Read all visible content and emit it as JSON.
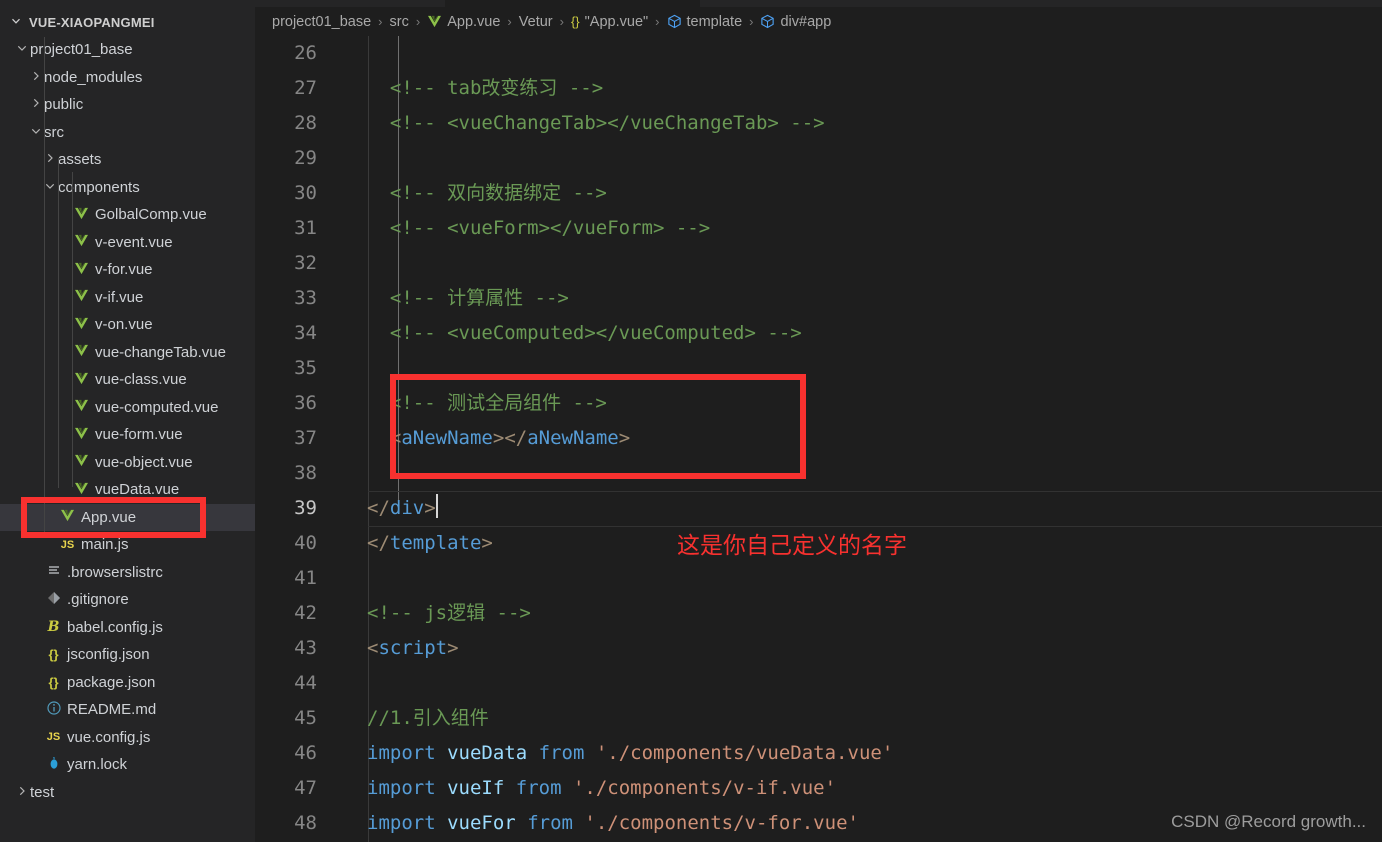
{
  "window": {
    "theme_bg": "#1e1e1e",
    "sidebar_bg": "#252526",
    "accent_red": "#f8312f"
  },
  "sidebar": {
    "title": "VUE-XIAOPANGMEI",
    "title_twisty": "chevron-down-icon",
    "items": [
      {
        "label": "project01_base",
        "twisty": "chevron-down-icon",
        "icon": "",
        "indent": 14,
        "selected": false
      },
      {
        "label": "node_modules",
        "twisty": "chevron-right-icon",
        "icon": "",
        "indent": 28,
        "selected": false
      },
      {
        "label": "public",
        "twisty": "chevron-right-icon",
        "icon": "",
        "indent": 28,
        "selected": false
      },
      {
        "label": "src",
        "twisty": "chevron-down-icon",
        "icon": "",
        "indent": 28,
        "selected": false
      },
      {
        "label": "assets",
        "twisty": "chevron-right-icon",
        "icon": "",
        "indent": 42,
        "selected": false
      },
      {
        "label": "components",
        "twisty": "chevron-down-icon",
        "icon": "",
        "indent": 42,
        "selected": false
      },
      {
        "label": "GolbalComp.vue",
        "twisty": "",
        "icon": "vue-icon",
        "indent": 56,
        "selected": false
      },
      {
        "label": "v-event.vue",
        "twisty": "",
        "icon": "vue-icon",
        "indent": 56,
        "selected": false
      },
      {
        "label": "v-for.vue",
        "twisty": "",
        "icon": "vue-icon",
        "indent": 56,
        "selected": false
      },
      {
        "label": "v-if.vue",
        "twisty": "",
        "icon": "vue-icon",
        "indent": 56,
        "selected": false
      },
      {
        "label": "v-on.vue",
        "twisty": "",
        "icon": "vue-icon",
        "indent": 56,
        "selected": false
      },
      {
        "label": "vue-changeTab.vue",
        "twisty": "",
        "icon": "vue-icon",
        "indent": 56,
        "selected": false
      },
      {
        "label": "vue-class.vue",
        "twisty": "",
        "icon": "vue-icon",
        "indent": 56,
        "selected": false
      },
      {
        "label": "vue-computed.vue",
        "twisty": "",
        "icon": "vue-icon",
        "indent": 56,
        "selected": false
      },
      {
        "label": "vue-form.vue",
        "twisty": "",
        "icon": "vue-icon",
        "indent": 56,
        "selected": false
      },
      {
        "label": "vue-object.vue",
        "twisty": "",
        "icon": "vue-icon",
        "indent": 56,
        "selected": false
      },
      {
        "label": "vueData.vue",
        "twisty": "",
        "icon": "vue-icon",
        "indent": 56,
        "selected": false
      },
      {
        "label": "App.vue",
        "twisty": "",
        "icon": "vue-icon",
        "indent": 42,
        "selected": true
      },
      {
        "label": "main.js",
        "twisty": "",
        "icon": "js-icon",
        "indent": 42,
        "selected": false
      },
      {
        "label": ".browserslistrc",
        "twisty": "",
        "icon": "list-icon",
        "indent": 28,
        "selected": false
      },
      {
        "label": ".gitignore",
        "twisty": "",
        "icon": "git-icon",
        "indent": 28,
        "selected": false
      },
      {
        "label": "babel.config.js",
        "twisty": "",
        "icon": "babel-icon",
        "indent": 28,
        "selected": false
      },
      {
        "label": "jsconfig.json",
        "twisty": "",
        "icon": "json-icon",
        "indent": 28,
        "selected": false
      },
      {
        "label": "package.json",
        "twisty": "",
        "icon": "json-icon",
        "indent": 28,
        "selected": false
      },
      {
        "label": "README.md",
        "twisty": "",
        "icon": "info-icon",
        "indent": 28,
        "selected": false
      },
      {
        "label": "vue.config.js",
        "twisty": "",
        "icon": "js-icon",
        "indent": 28,
        "selected": false
      },
      {
        "label": "yarn.lock",
        "twisty": "",
        "icon": "yarn-icon",
        "indent": 28,
        "selected": false
      },
      {
        "label": "test",
        "twisty": "chevron-right-icon",
        "icon": "",
        "indent": 14,
        "selected": false
      }
    ]
  },
  "breadcrumb": {
    "items": [
      {
        "label": "project01_base",
        "icon": ""
      },
      {
        "label": "src",
        "icon": ""
      },
      {
        "label": "App.vue",
        "icon": "vue-icon"
      },
      {
        "label": "Vetur",
        "icon": ""
      },
      {
        "label": "\"App.vue\"",
        "icon": "json-icon"
      },
      {
        "label": "template",
        "icon": "symbol-struct-icon"
      },
      {
        "label": "div#app",
        "icon": "symbol-struct-icon"
      }
    ],
    "separator": "›"
  },
  "editor": {
    "active_line": 39,
    "first_visible_line": 26,
    "lines": [
      {
        "n": 26,
        "tokens": []
      },
      {
        "n": 27,
        "tokens": [
          {
            "t": "plain",
            "v": "  "
          },
          {
            "t": "comment",
            "v": "<!-- tab改变练习 -->"
          }
        ]
      },
      {
        "n": 28,
        "tokens": [
          {
            "t": "plain",
            "v": "  "
          },
          {
            "t": "comment",
            "v": "<!-- <vueChangeTab></vueChangeTab> -->"
          }
        ]
      },
      {
        "n": 29,
        "tokens": []
      },
      {
        "n": 30,
        "tokens": [
          {
            "t": "plain",
            "v": "  "
          },
          {
            "t": "comment",
            "v": "<!-- 双向数据绑定 -->"
          }
        ]
      },
      {
        "n": 31,
        "tokens": [
          {
            "t": "plain",
            "v": "  "
          },
          {
            "t": "comment",
            "v": "<!-- <vueForm></vueForm> -->"
          }
        ]
      },
      {
        "n": 32,
        "tokens": []
      },
      {
        "n": 33,
        "tokens": [
          {
            "t": "plain",
            "v": "  "
          },
          {
            "t": "comment",
            "v": "<!-- 计算属性 -->"
          }
        ]
      },
      {
        "n": 34,
        "tokens": [
          {
            "t": "plain",
            "v": "  "
          },
          {
            "t": "comment",
            "v": "<!-- <vueComputed></vueComputed> -->"
          }
        ]
      },
      {
        "n": 35,
        "tokens": []
      },
      {
        "n": 36,
        "tokens": [
          {
            "t": "plain",
            "v": "  "
          },
          {
            "t": "comment",
            "v": "<!-- 测试全局组件 -->"
          }
        ]
      },
      {
        "n": 37,
        "tokens": [
          {
            "t": "plain",
            "v": "  "
          },
          {
            "t": "bracket",
            "v": "<"
          },
          {
            "t": "tag",
            "v": "aNewName"
          },
          {
            "t": "bracket",
            "v": ">"
          },
          {
            "t": "bracket",
            "v": "</"
          },
          {
            "t": "tag",
            "v": "aNewName"
          },
          {
            "t": "bracket",
            "v": ">"
          }
        ]
      },
      {
        "n": 38,
        "tokens": []
      },
      {
        "n": 39,
        "tokens": [
          {
            "t": "bracket",
            "v": "</"
          },
          {
            "t": "tag",
            "v": "div"
          },
          {
            "t": "bracket",
            "v": ">"
          },
          {
            "t": "cursor",
            "v": ""
          }
        ]
      },
      {
        "n": 40,
        "tokens": [
          {
            "t": "bracket",
            "v": "</"
          },
          {
            "t": "tag",
            "v": "template"
          },
          {
            "t": "bracket",
            "v": ">"
          }
        ]
      },
      {
        "n": 41,
        "tokens": []
      },
      {
        "n": 42,
        "tokens": [
          {
            "t": "comment",
            "v": "<!-- js逻辑 -->"
          }
        ]
      },
      {
        "n": 43,
        "tokens": [
          {
            "t": "bracket",
            "v": "<"
          },
          {
            "t": "tag",
            "v": "script"
          },
          {
            "t": "bracket",
            "v": ">"
          }
        ]
      },
      {
        "n": 44,
        "tokens": []
      },
      {
        "n": 45,
        "tokens": [
          {
            "t": "comment",
            "v": "//1.引入组件"
          }
        ]
      },
      {
        "n": 46,
        "tokens": [
          {
            "t": "kw",
            "v": "import"
          },
          {
            "t": "plain",
            "v": " "
          },
          {
            "t": "ident",
            "v": "vueData"
          },
          {
            "t": "plain",
            "v": " "
          },
          {
            "t": "kw",
            "v": "from"
          },
          {
            "t": "plain",
            "v": " "
          },
          {
            "t": "str",
            "v": "'./components/vueData.vue'"
          }
        ]
      },
      {
        "n": 47,
        "tokens": [
          {
            "t": "kw",
            "v": "import"
          },
          {
            "t": "plain",
            "v": " "
          },
          {
            "t": "ident",
            "v": "vueIf"
          },
          {
            "t": "plain",
            "v": " "
          },
          {
            "t": "kw",
            "v": "from"
          },
          {
            "t": "plain",
            "v": " "
          },
          {
            "t": "str",
            "v": "'./components/v-if.vue'"
          }
        ]
      },
      {
        "n": 48,
        "tokens": [
          {
            "t": "kw",
            "v": "import"
          },
          {
            "t": "plain",
            "v": " "
          },
          {
            "t": "ident",
            "v": "vueFor"
          },
          {
            "t": "plain",
            "v": " "
          },
          {
            "t": "kw",
            "v": "from"
          },
          {
            "t": "plain",
            "v": " "
          },
          {
            "t": "str",
            "v": "'./components/v-for.vue'"
          }
        ]
      }
    ]
  },
  "annotations": {
    "code_box_target": "lines 36-37",
    "sidebar_box_target": "App.vue",
    "note_text": "这是你自己定义的名字"
  },
  "watermark": {
    "text": "CSDN @Record growth..."
  }
}
